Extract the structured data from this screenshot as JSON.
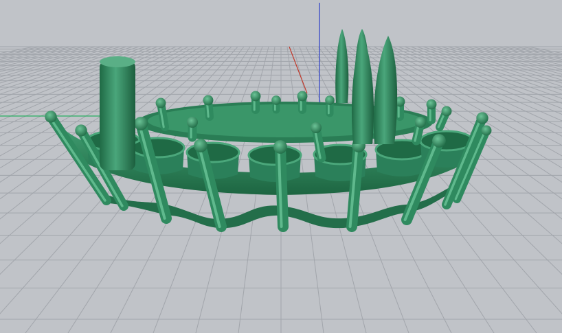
{
  "viewport": {
    "label": "",
    "background_color": "#bfc2c7",
    "grid_color": "#9ea2a8",
    "grid_major_color": "#8e9298",
    "model_color": "#2f8a5f",
    "model_shadow_color": "#1f6a45",
    "model_highlight_color": "#57b086",
    "axis_x_color": "#c0392b",
    "axis_y_color": "#27ae60",
    "axis_z_color": "#2c3ec9"
  }
}
